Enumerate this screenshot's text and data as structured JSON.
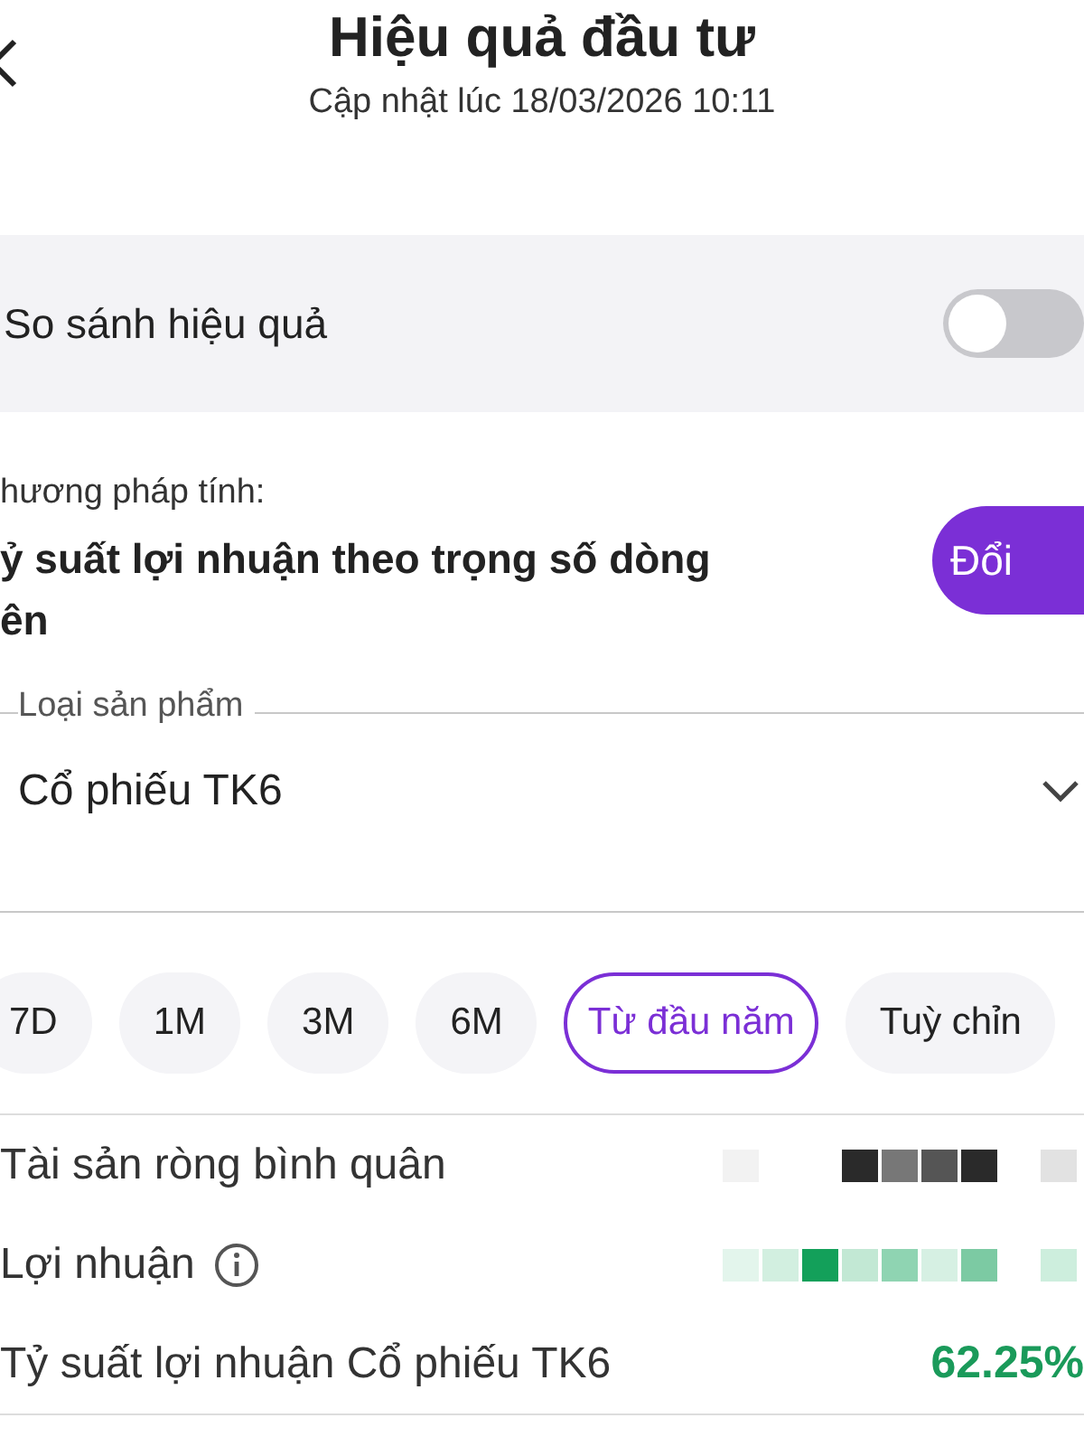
{
  "header": {
    "title": "Hiệu quả đầu tư",
    "subtitle": "Cập nhật lúc 18/03/2026 10:11"
  },
  "compare": {
    "label": "So sánh hiệu quả",
    "on": false
  },
  "method": {
    "label": "hương pháp tính:",
    "lines": [
      "ỷ suất lợi nhuận theo trọng số dòng",
      "ên"
    ],
    "button": "Đổi"
  },
  "product": {
    "label": "Loại sản phẩm",
    "value": "Cổ phiếu TK6"
  },
  "periods": [
    {
      "label": "7D",
      "selected": false
    },
    {
      "label": "1M",
      "selected": false
    },
    {
      "label": "3M",
      "selected": false
    },
    {
      "label": "6M",
      "selected": false
    },
    {
      "label": "Từ đầu năm",
      "selected": true
    },
    {
      "label": "Tuỳ chỉn",
      "selected": false
    }
  ],
  "metrics": [
    {
      "label": "Tài sản ròng bình quân",
      "kind": "masked",
      "info": false,
      "positive": false
    },
    {
      "label": "Lợi nhuận",
      "kind": "masked",
      "info": true,
      "positive": true
    },
    {
      "label": "Tỷ suất lợi nhuận Cổ phiếu TK6",
      "kind": "text",
      "value": "62.25%",
      "info": false,
      "positive": true
    }
  ]
}
